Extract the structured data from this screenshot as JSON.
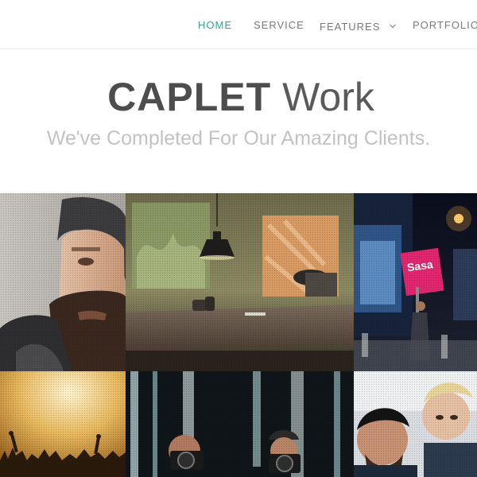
{
  "nav": {
    "items": [
      {
        "label": "HOME"
      },
      {
        "label": "SERVICE"
      },
      {
        "label": "FEATURES"
      },
      {
        "label": "PORTFOLIO"
      }
    ]
  },
  "hero": {
    "title_bold": "CAPLET",
    "title_light": "Work",
    "subtitle": "We've Completed For Our Amazing Clients."
  },
  "photos": {
    "sign_text": "Sasa"
  },
  "colors": {
    "accent": "#2aa6a0",
    "nav_text": "#7a7a7a",
    "title": "#4d4d4d",
    "subtitle": "#c3c3c3"
  }
}
